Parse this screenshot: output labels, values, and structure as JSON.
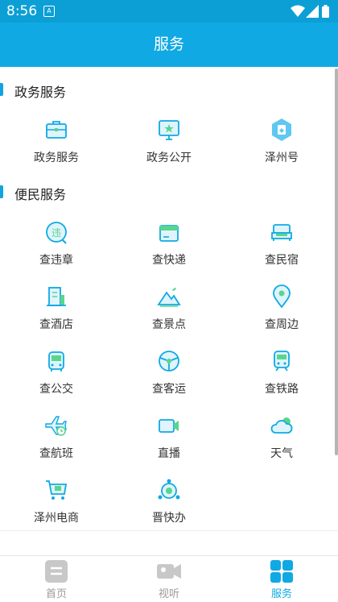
{
  "status_bar": {
    "time": "8:56",
    "notification_icon": "A"
  },
  "header": {
    "title": "服务"
  },
  "sections": [
    {
      "title": "政务服务",
      "items": [
        {
          "label": "政务服务",
          "icon": "briefcase-icon"
        },
        {
          "label": "政务公开",
          "icon": "monitor-star-icon"
        },
        {
          "label": "泽州号",
          "icon": "hexagon-badge-icon"
        }
      ]
    },
    {
      "title": "便民服务",
      "items": [
        {
          "label": "查违章",
          "icon": "violation-icon",
          "badge": "违"
        },
        {
          "label": "查快递",
          "icon": "parcel-box-icon"
        },
        {
          "label": "查民宿",
          "icon": "bed-icon"
        },
        {
          "label": "查酒店",
          "icon": "hotel-building-icon"
        },
        {
          "label": "查景点",
          "icon": "mountain-scenery-icon"
        },
        {
          "label": "查周边",
          "icon": "location-pin-icon"
        },
        {
          "label": "查公交",
          "icon": "bus-icon"
        },
        {
          "label": "查客运",
          "icon": "steering-wheel-icon"
        },
        {
          "label": "查铁路",
          "icon": "train-icon"
        },
        {
          "label": "查航班",
          "icon": "plane-clock-icon"
        },
        {
          "label": "直播",
          "icon": "video-camera-icon"
        },
        {
          "label": "天气",
          "icon": "cloud-weather-icon"
        },
        {
          "label": "泽州电商",
          "icon": "shopping-cart-icon"
        },
        {
          "label": "晋快办",
          "icon": "network-nodes-icon"
        }
      ]
    }
  ],
  "tabs": [
    {
      "label": "首页",
      "icon": "home-doc-icon",
      "active": false
    },
    {
      "label": "视听",
      "icon": "video-tab-icon",
      "active": false
    },
    {
      "label": "服务",
      "icon": "grid-tab-icon",
      "active": true
    }
  ],
  "colors": {
    "primary": "#10a9e3",
    "accent_green": "#58d68d",
    "inactive": "#c8c8c8"
  }
}
